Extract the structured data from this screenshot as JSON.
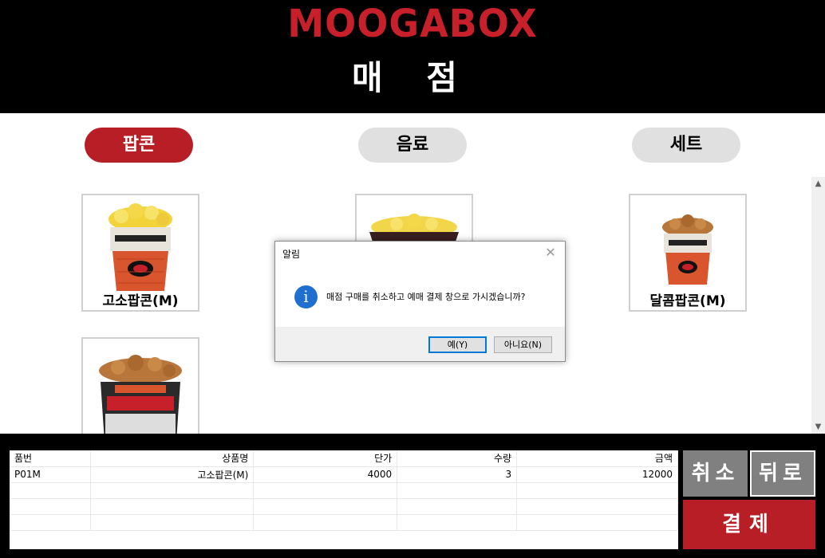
{
  "header": {
    "brand": "MOOGABOX",
    "title": "매 점"
  },
  "colors": {
    "accent": "#b81e25",
    "header_bg": "#000000",
    "inactive_tab": "#e0e0e0",
    "button_gray": "#808080",
    "info_blue": "#1f6fd0"
  },
  "tabs": [
    {
      "label": "팝콘",
      "active": true
    },
    {
      "label": "음료",
      "active": false
    },
    {
      "label": "세트",
      "active": false
    }
  ],
  "products": [
    {
      "label": "고소팝콘(M)",
      "icon": "popcorn-bucket-icon"
    },
    {
      "label": "",
      "icon": "popcorn-bowl-icon"
    },
    {
      "label": "달콤팝콘(M)",
      "icon": "caramel-popcorn-icon"
    },
    {
      "label": "",
      "icon": "popcorn-large-icon"
    }
  ],
  "order": {
    "columns": [
      "품번",
      "상품명",
      "단가",
      "수량",
      "금액"
    ],
    "rows": [
      [
        "P01M",
        "고소팝콘(M)",
        "4000",
        "3",
        "12000"
      ]
    ]
  },
  "buttons": {
    "cancel": "취소",
    "back": "뒤로",
    "pay": "결제"
  },
  "dialog": {
    "title": "알림",
    "message": "매점 구매를 취소하고 예매 결제 창으로 가시겠습니까?",
    "yes": "예(Y)",
    "no": "아니요(N)",
    "icon": "info-icon"
  }
}
